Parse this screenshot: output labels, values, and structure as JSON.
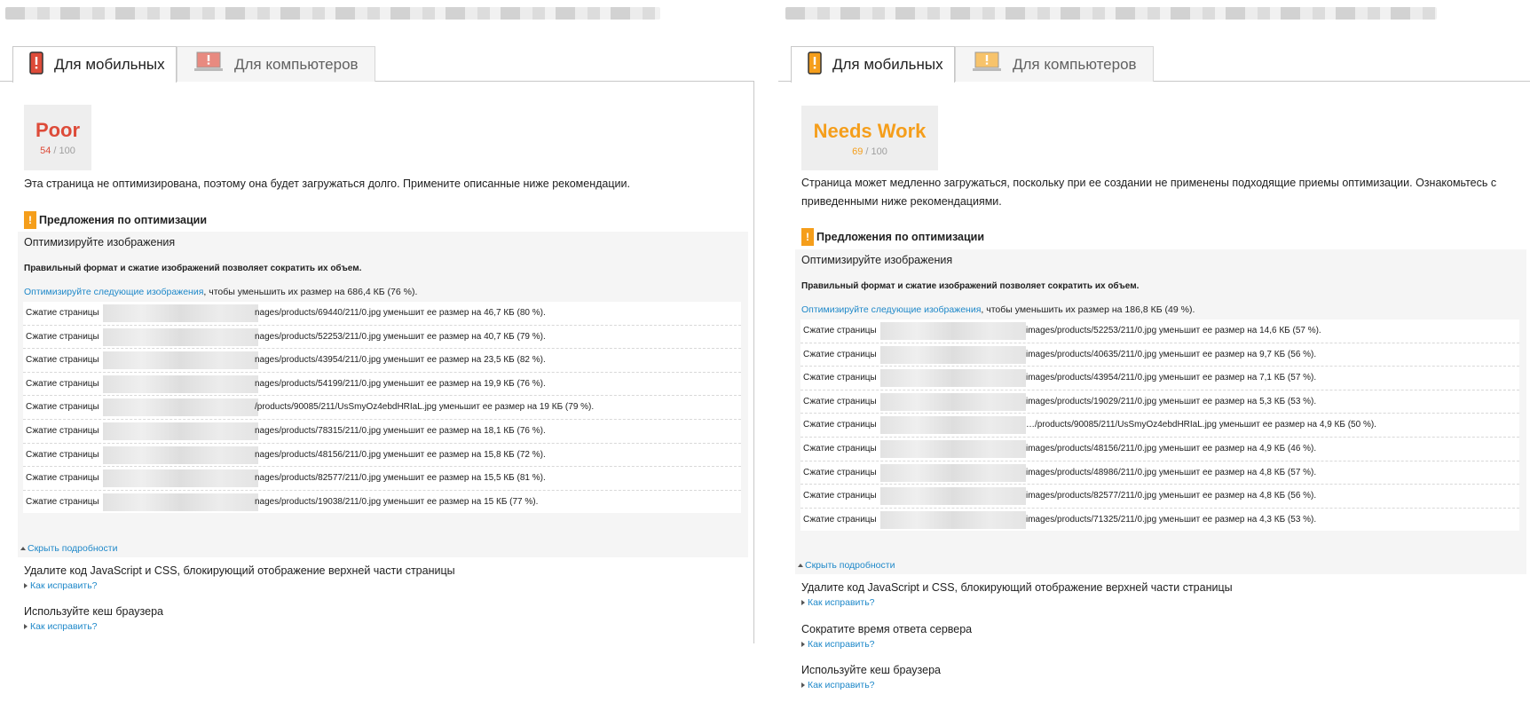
{
  "colors": {
    "poor": "#dd4b39",
    "needs_work": "#f59e1b",
    "link": "#1e88c9"
  },
  "panels": [
    {
      "tabs": {
        "mobile": "Для мобильных",
        "desktop": "Для компьютеров"
      },
      "score": {
        "label": "Poor",
        "value": "54",
        "max": "/ 100",
        "level": "poor"
      },
      "summary": "Эта страница не оптимизирована, поэтому она будет загружаться долго. Примените описанные ниже рекомендации.",
      "optimization_heading": "Предложения по оптимизации",
      "rule": {
        "title": "Оптимизируйте изображения",
        "description": "Правильный формат и сжатие изображений позволяет сократить их объем.",
        "link": "Оптимизируйте следующие изображения",
        "link_suffix": ", чтобы уменьшить их размер на 686,4 КБ (76 %).",
        "rows": [
          {
            "prefix": "Сжатие страницы",
            "rest": "nages/products/69440/211/0.jpg уменьшит ее размер на 46,7 КБ (80 %)."
          },
          {
            "prefix": "Сжатие страницы",
            "rest": "nages/products/52253/211/0.jpg уменьшит ее размер на 40,7 КБ (79 %)."
          },
          {
            "prefix": "Сжатие страницы",
            "rest": "nages/products/43954/211/0.jpg уменьшит ее размер на 23,5 КБ (82 %)."
          },
          {
            "prefix": "Сжатие страницы",
            "rest": "nages/products/54199/211/0.jpg уменьшит ее размер на 19,9 КБ (76 %)."
          },
          {
            "prefix": "Сжатие страницы",
            "rest": "/products/90085/211/UsSmyOz4ebdHRIaL.jpg уменьшит ее размер на 19 КБ (79 %)."
          },
          {
            "prefix": "Сжатие страницы",
            "rest": "nages/products/78315/211/0.jpg уменьшит ее размер на 18,1 КБ (76 %)."
          },
          {
            "prefix": "Сжатие страницы",
            "rest": "nages/products/48156/211/0.jpg уменьшит ее размер на 15,8 КБ (72 %)."
          },
          {
            "prefix": "Сжатие страницы",
            "rest": "nages/products/82577/211/0.jpg уменьшит ее размер на 15,5 КБ (81 %)."
          },
          {
            "prefix": "Сжатие страницы",
            "rest": "nages/products/19038/211/0.jpg уменьшит ее размер на 15 КБ (77 %)."
          }
        ],
        "hide_details": "Скрыть подробности"
      },
      "collapsed_rules": [
        {
          "title": "Удалите код JavaScript и CSS, блокирующий отображение верхней части страницы",
          "link": "Как исправить?"
        },
        {
          "title": "Используйте кеш браузера",
          "link": "Как исправить?"
        }
      ]
    },
    {
      "tabs": {
        "mobile": "Для мобильных",
        "desktop": "Для компьютеров"
      },
      "score": {
        "label": "Needs Work",
        "value": "69",
        "max": "/ 100",
        "level": "needs_work"
      },
      "summary": "Страница может медленно загружаться, поскольку при ее создании не применены подходящие приемы оптимизации. Ознакомьтесь с приведенными ниже рекомендациями.",
      "optimization_heading": "Предложения по оптимизации",
      "rule": {
        "title": "Оптимизируйте изображения",
        "description": "Правильный формат и сжатие изображений позволяет сократить их объем.",
        "link": "Оптимизируйте следующие изображения",
        "link_suffix": ", чтобы уменьшить их размер на 186,8 КБ (49 %).",
        "rows": [
          {
            "prefix": "Сжатие страницы",
            "rest": "images/products/52253/211/0.jpg уменьшит ее размер на 14,6 КБ (57 %)."
          },
          {
            "prefix": "Сжатие страницы",
            "rest": "images/products/40635/211/0.jpg уменьшит ее размер на 9,7 КБ (56 %)."
          },
          {
            "prefix": "Сжатие страницы",
            "rest": "images/products/43954/211/0.jpg уменьшит ее размер на 7,1 КБ (57 %)."
          },
          {
            "prefix": "Сжатие страницы",
            "rest": "images/products/19029/211/0.jpg уменьшит ее размер на 5,3 КБ (53 %)."
          },
          {
            "prefix": "Сжатие страницы",
            "rest": "…/products/90085/211/UsSmyOz4ebdHRIaL.jpg уменьшит ее размер на 4,9 КБ (50 %)."
          },
          {
            "prefix": "Сжатие страницы",
            "rest": "images/products/48156/211/0.jpg уменьшит ее размер на 4,9 КБ (46 %)."
          },
          {
            "prefix": "Сжатие страницы",
            "rest": "images/products/48986/211/0.jpg уменьшит ее размер на 4,8 КБ (57 %)."
          },
          {
            "prefix": "Сжатие страницы",
            "rest": "images/products/82577/211/0.jpg уменьшит ее размер на 4,8 КБ (56 %)."
          },
          {
            "prefix": "Сжатие страницы",
            "rest": "images/products/71325/211/0.jpg уменьшит ее размер на 4,3 КБ (53 %)."
          }
        ],
        "hide_details": "Скрыть подробности"
      },
      "collapsed_rules": [
        {
          "title": "Удалите код JavaScript и CSS, блокирующий отображение верхней части страницы",
          "link": "Как исправить?"
        },
        {
          "title": "Сократите время ответа сервера",
          "link": "Как исправить?"
        },
        {
          "title": "Используйте кеш браузера",
          "link": "Как исправить?"
        }
      ]
    }
  ]
}
